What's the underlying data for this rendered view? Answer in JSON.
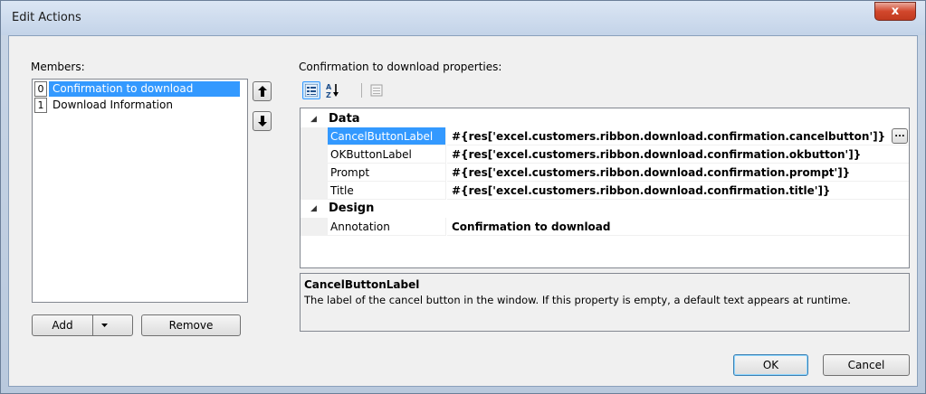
{
  "window": {
    "title": "Edit Actions",
    "close_label": "x"
  },
  "members": {
    "label": "Members:",
    "items": [
      {
        "index": "0",
        "label": "Confirmation to download",
        "selected": true
      },
      {
        "index": "1",
        "label": "Download Information",
        "selected": false
      }
    ],
    "add_label": "Add",
    "remove_label": "Remove"
  },
  "properties": {
    "label": "Confirmation to download properties:",
    "categories": [
      {
        "name": "Data",
        "props": [
          {
            "name": "CancelButtonLabel",
            "value": "#{res['excel.customers.ribbon.download.confirmation.cancelbutton']}",
            "selected": true
          },
          {
            "name": "OKButtonLabel",
            "value": "#{res['excel.customers.ribbon.download.confirmation.okbutton']}",
            "selected": false
          },
          {
            "name": "Prompt",
            "value": "#{res['excel.customers.ribbon.download.confirmation.prompt']}",
            "selected": false
          },
          {
            "name": "Title",
            "value": "#{res['excel.customers.ribbon.download.confirmation.title']}",
            "selected": false
          }
        ]
      },
      {
        "name": "Design",
        "props": [
          {
            "name": "Annotation",
            "value": "Confirmation to download",
            "selected": false
          }
        ]
      }
    ],
    "ellipsis_label": "...",
    "description": {
      "title": "CancelButtonLabel",
      "text": "The label of the cancel button in the window. If this property is empty, a default text appears at runtime."
    }
  },
  "footer": {
    "ok_label": "OK",
    "cancel_label": "Cancel"
  },
  "colors": {
    "selection": "#3399ff",
    "close_button": "#d2472c"
  }
}
